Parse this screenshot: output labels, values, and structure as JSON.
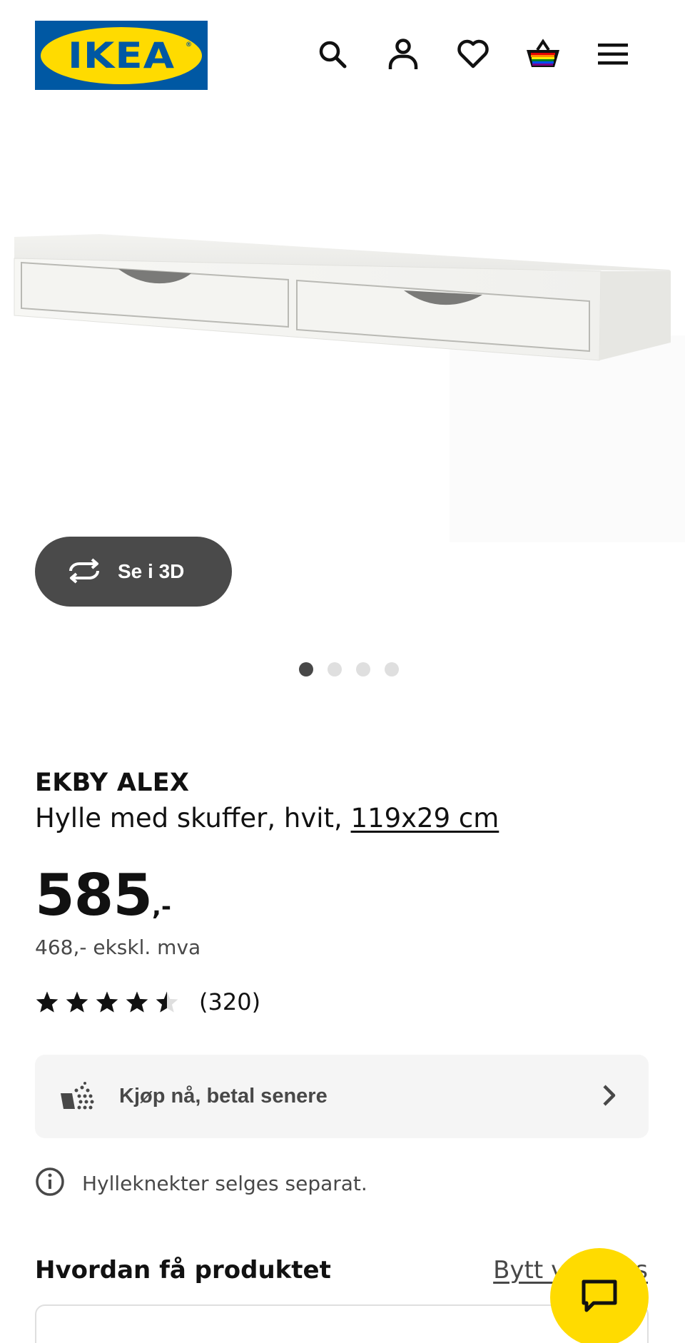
{
  "header": {
    "logo_text": "IKEA",
    "logo_reg": "®",
    "icons": [
      "search-icon",
      "account-icon",
      "heart-icon",
      "basket-icon",
      "menu-icon"
    ]
  },
  "gallery": {
    "view_3d_label": "Se i 3D",
    "total_images": 4,
    "active_index": 0
  },
  "product": {
    "name": "EKBY ALEX",
    "description": "Hylle med skuffer, hvit, ",
    "dimensions": "119x29 cm",
    "price_integer": "585",
    "price_suffix": ",-",
    "price_ex_vat": "468,- ekskl. mva",
    "rating_value": 4.5,
    "rating_max": 5,
    "rating_count": "(320)"
  },
  "payment": {
    "label": "Kjøp nå, betal senere"
  },
  "notice": {
    "text": "Hylleknekter selges separat."
  },
  "delivery": {
    "title": "Hvordan få produktet",
    "change_link": "Bytt varehus"
  },
  "colors": {
    "ikea_blue": "#0058a3",
    "ikea_yellow": "#ffdb00",
    "button_dark": "#4a4a4a",
    "text_primary": "#111111",
    "text_secondary": "#484848"
  }
}
